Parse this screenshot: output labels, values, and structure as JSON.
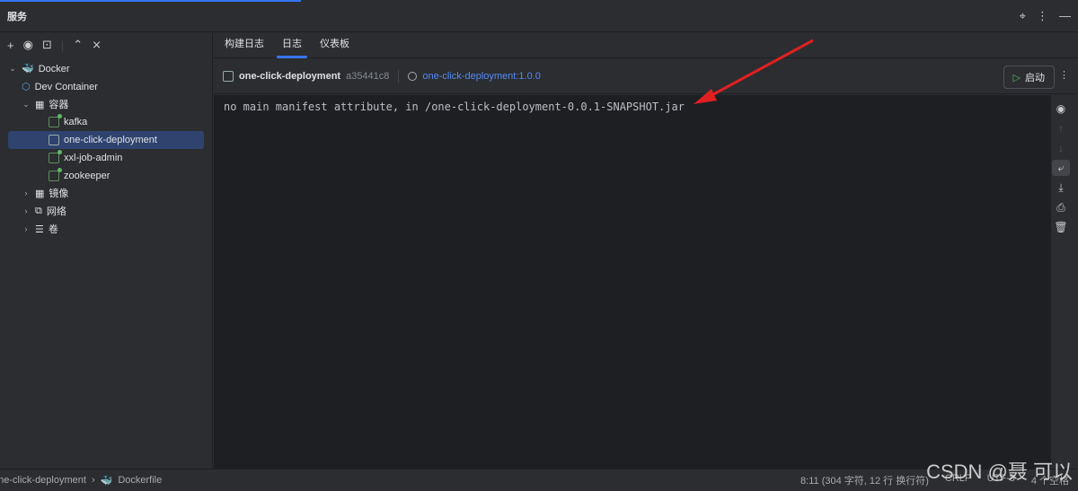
{
  "window": {
    "title": "服务"
  },
  "sidebar": {
    "tree": [
      {
        "label": "Docker"
      },
      {
        "label": "Dev Container"
      },
      {
        "label": "容器"
      },
      {
        "label": "kafka"
      },
      {
        "label": "one-click-deployment"
      },
      {
        "label": "xxl-job-admin"
      },
      {
        "label": "zookeeper"
      },
      {
        "label": "镜像"
      },
      {
        "label": "网络"
      },
      {
        "label": "卷"
      }
    ]
  },
  "tabs": [
    {
      "label": "构建日志"
    },
    {
      "label": "日志"
    },
    {
      "label": "仪表板"
    }
  ],
  "header": {
    "container": "one-click-deployment",
    "hash": "a35441c8",
    "image": "one-click-deployment:1.0.0",
    "start_label": "启动"
  },
  "log": {
    "line": "no main manifest attribute, in /one-click-deployment-0.0.1-SNAPSHOT.jar"
  },
  "status": {
    "crumb1": "one-click-deployment",
    "crumb2": "Dockerfile",
    "position": "8:11 (304 字符, 12 行 换行符)",
    "eol": "CRLF",
    "encoding": "UTF-8",
    "indent": "4 个空格"
  },
  "watermark": "CSDN @聂 可以"
}
